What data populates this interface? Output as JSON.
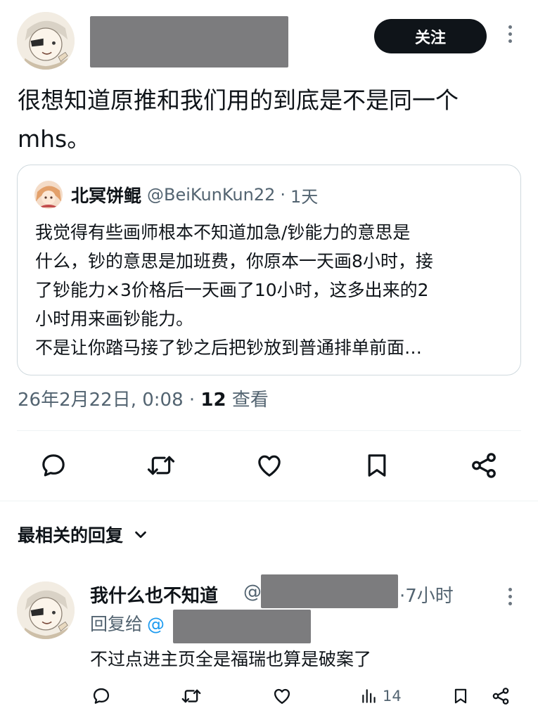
{
  "post": {
    "follow_label": "关注",
    "text": "很想知道原推和我们用的到底是不是同一个mhs。",
    "meta": {
      "date": "26年2月22日, 0:08 · ",
      "views_count": "12",
      "views_label": " 查看"
    }
  },
  "quote": {
    "name": "北冥饼鲲",
    "handle": "@BeiKunKun22",
    "separator": "·",
    "time": "1天",
    "lines": [
      "我觉得有些画师根本不知道加急/钞能力的意思是",
      "什么，钞的意思是加班费，你原本一天画8小时，接",
      "了钞能力×3价格后一天画了10小时，这多出来的2",
      "小时用来画钞能力。",
      "不是让你踏马接了钞之后把钞放到普通排单前面…"
    ]
  },
  "replies_sort": {
    "label": "最相关的回复"
  },
  "reply": {
    "name": "我什么也不知道",
    "at": "@",
    "time": "·7小时",
    "reply_to_label": "回复给",
    "reply_to_at": "@",
    "text": "不过点进主页全是福瑞也算是破案了",
    "views": "14"
  },
  "icons": {
    "actions": [
      "reply-icon",
      "retweet-icon",
      "like-icon",
      "bookmark-icon",
      "share-icon",
      "views-icon",
      "more-icon",
      "chevron-down-icon"
    ]
  },
  "colors": {
    "text": "#0f1419",
    "secondary": "#536471",
    "border": "#cfd9de",
    "link": "#1d9bf0",
    "button_bg": "#0f1419"
  }
}
